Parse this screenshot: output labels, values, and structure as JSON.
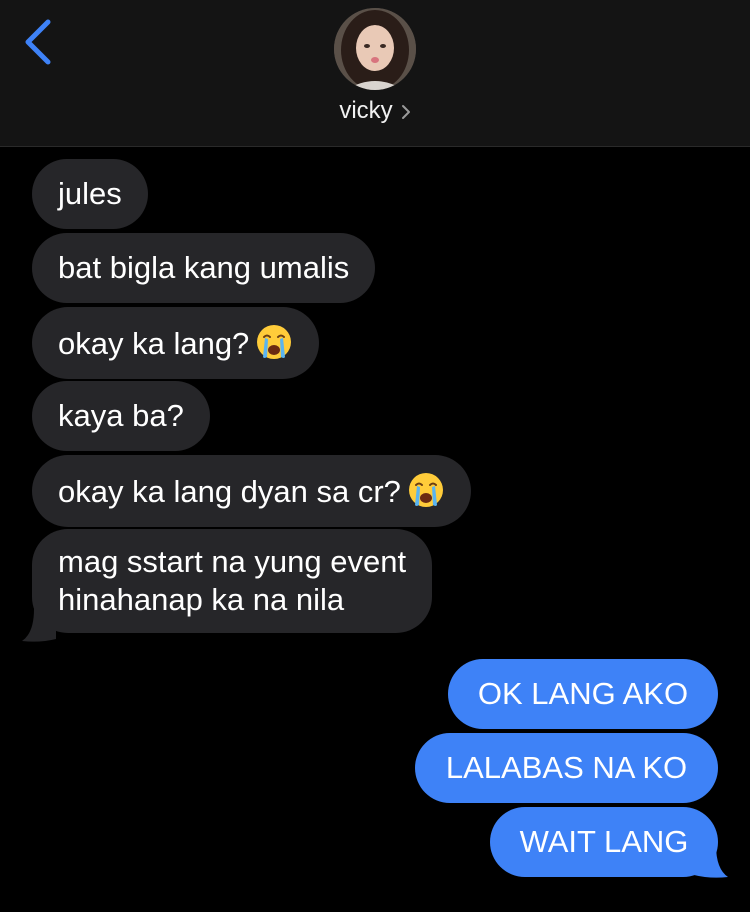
{
  "header": {
    "contact_name": "vicky"
  },
  "messages": {
    "incoming": [
      {
        "text": "jules"
      },
      {
        "text": "bat bigla kang umalis"
      },
      {
        "text": "okay ka lang?",
        "emoji": "crying-face"
      },
      {
        "text": "kaya ba?"
      },
      {
        "text": "okay ka lang dyan sa cr?",
        "emoji": "crying-face"
      },
      {
        "line1": "mag sstart na yung event",
        "line2": "hinahanap ka na nila"
      }
    ],
    "outgoing": [
      {
        "text": "OK LANG AKO"
      },
      {
        "text": "LALABAS NA KO"
      },
      {
        "text": "WAIT LANG"
      }
    ]
  },
  "colors": {
    "incoming_bubble": "#262629",
    "outgoing_bubble": "#3e82f7",
    "accent": "#3e82f7",
    "background": "#000000"
  }
}
